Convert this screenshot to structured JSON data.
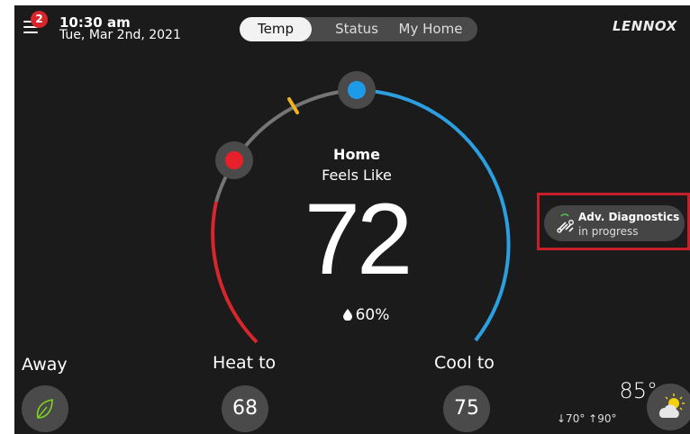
{
  "header": {
    "notification_count": "2",
    "time": "10:30 am",
    "date": "Tue, Mar 2nd, 2021",
    "tabs": [
      {
        "label": "Temp",
        "active": true
      },
      {
        "label": "Status",
        "active": false
      },
      {
        "label": "My Home",
        "active": false
      }
    ],
    "brand": "LENNOX"
  },
  "main": {
    "mode": "Home",
    "feels_like_label": "Feels Like",
    "temperature": "72",
    "humidity_icon": "droplet-icon",
    "humidity": "60%"
  },
  "diagnostics": {
    "title": "Adv. Diagnostics",
    "status": "in progress",
    "icon": "tools-icon"
  },
  "controls": {
    "away_label": "Away",
    "away_icon": "leaf-icon",
    "heat_label": "Heat to",
    "heat_setpoint": "68",
    "cool_label": "Cool to",
    "cool_setpoint": "75"
  },
  "weather": {
    "outdoor_temp": "85°",
    "low": "↓70°",
    "high": "↑90°",
    "icon": "partly-cloudy-icon"
  },
  "colors": {
    "heat": "#d9262c",
    "cool": "#2b9fe0",
    "highlight_outline": "#c8202a",
    "marker": "#f0b41c",
    "away_leaf": "#7ed321"
  }
}
